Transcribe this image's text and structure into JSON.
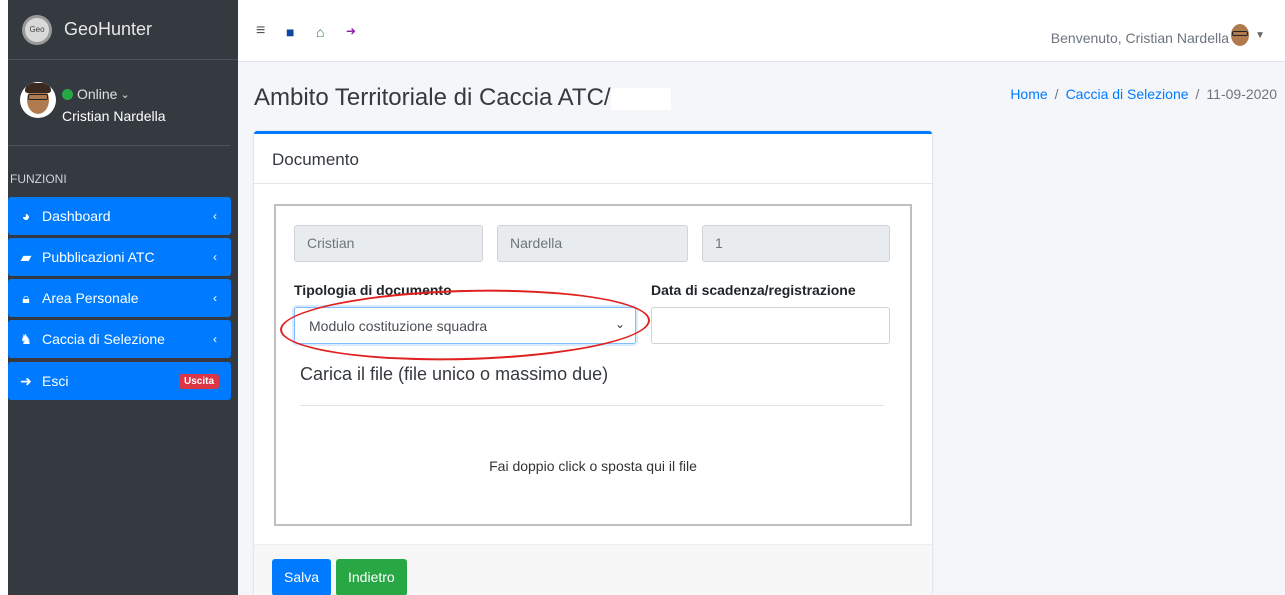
{
  "app": {
    "name": "GeoHunter",
    "logo_text": "Geo"
  },
  "user": {
    "status": "Online",
    "name": "Cristian Nardella"
  },
  "sidebar": {
    "section_label": "FUNZIONI",
    "items": [
      {
        "label": "Dashboard",
        "icon": "dashboard-icon"
      },
      {
        "label": "Pubblicazioni ATC",
        "icon": "book-icon"
      },
      {
        "label": "Area Personale",
        "icon": "lock-icon"
      },
      {
        "label": "Caccia di Selezione",
        "icon": "deer-icon"
      },
      {
        "label": "Esci",
        "icon": "sign-out-icon",
        "badge": "Uscita"
      }
    ]
  },
  "topbar": {
    "welcome": "Benvenuto, Cristian Nardella",
    "icons": [
      "menu-icon",
      "grid-icon",
      "home-icon",
      "sign-out-icon"
    ]
  },
  "header": {
    "title": "Ambito Territoriale di Caccia ATC/",
    "breadcrumb": {
      "home": "Home",
      "section": "Caccia di Selezione",
      "current": "11-09-2020"
    }
  },
  "card": {
    "title": "Documento",
    "first_name": "Cristian",
    "last_name": "Nardella",
    "number": "1",
    "doc_type_label": "Tipologia di documento",
    "doc_type_value": "Modulo costituzione squadra",
    "date_label": "Data di scadenza/registrazione",
    "date_value": "",
    "upload_label": "Carica il file (file unico o massimo due)",
    "drop_text": "Fai doppio click o sposta qui il file",
    "save_label": "Salva",
    "back_label": "Indietro"
  },
  "colors": {
    "primary": "#007bff",
    "success": "#28a745",
    "danger": "#dc3545",
    "sidebar": "#343a40",
    "annotation": "#e0201e"
  }
}
